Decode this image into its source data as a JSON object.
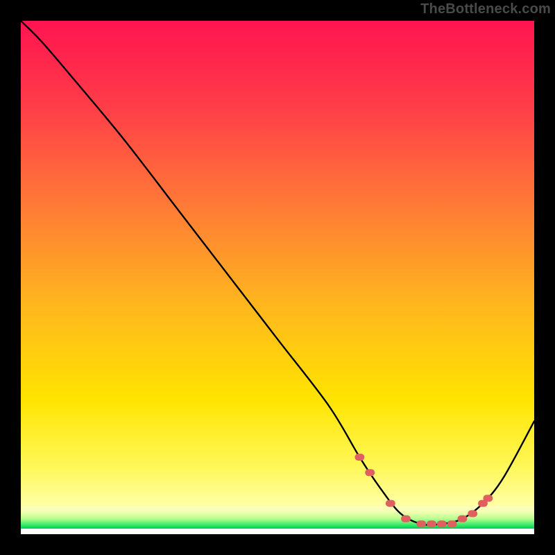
{
  "watermark": "TheBottleneck.com",
  "chart_data": {
    "type": "line",
    "title": "",
    "xlabel": "",
    "ylabel": "",
    "xlim": [
      0,
      100
    ],
    "ylim": [
      0,
      100
    ],
    "grid": false,
    "legend": false,
    "background_gradient": {
      "top_color": "#ff1450",
      "mid_color": "#ffe000",
      "bottom_color_band": "#00e060",
      "very_bottom_color": "#ffffff"
    },
    "series": [
      {
        "name": "bottleneck-curve",
        "color": "#000000",
        "x": [
          0,
          4,
          10,
          20,
          30,
          40,
          50,
          60,
          66,
          70,
          74,
          78,
          82,
          86,
          90,
          94,
          100
        ],
        "y": [
          100,
          96,
          89,
          77,
          64,
          51,
          38,
          25,
          15,
          9,
          4,
          2,
          2,
          3,
          6,
          11,
          22
        ]
      }
    ],
    "markers": {
      "name": "highlight-dots",
      "color": "#e06060",
      "shape": "rounded-rect",
      "points": [
        {
          "x": 66,
          "y": 15
        },
        {
          "x": 68,
          "y": 12
        },
        {
          "x": 72,
          "y": 6
        },
        {
          "x": 75,
          "y": 3
        },
        {
          "x": 78,
          "y": 2
        },
        {
          "x": 80,
          "y": 2
        },
        {
          "x": 82,
          "y": 2
        },
        {
          "x": 84,
          "y": 2
        },
        {
          "x": 86,
          "y": 3
        },
        {
          "x": 88,
          "y": 4
        },
        {
          "x": 90,
          "y": 6
        },
        {
          "x": 91,
          "y": 7
        }
      ]
    }
  }
}
